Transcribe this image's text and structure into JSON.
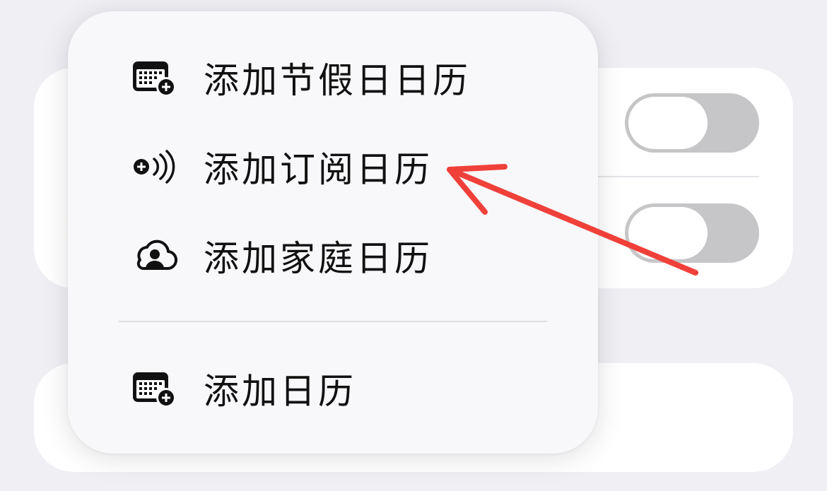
{
  "menu": {
    "items": [
      {
        "label": "添加节假日日历",
        "icon": "calendar-add-icon"
      },
      {
        "label": "添加订阅日历",
        "icon": "subscription-broadcast-icon"
      },
      {
        "label": "添加家庭日历",
        "icon": "family-cloud-icon"
      },
      {
        "label": "添加日历",
        "icon": "calendar-add-icon"
      }
    ]
  },
  "background": {
    "toggles": [
      {
        "state": "off"
      },
      {
        "state": "off"
      }
    ]
  },
  "annotation": {
    "arrow_color": "#f0403a",
    "points_to": "添加订阅日历"
  },
  "colors": {
    "page_bg": "#efeff4",
    "menu_bg": "#f8f8fa",
    "toggle_off": "#c6c6c8",
    "text": "#111111"
  }
}
